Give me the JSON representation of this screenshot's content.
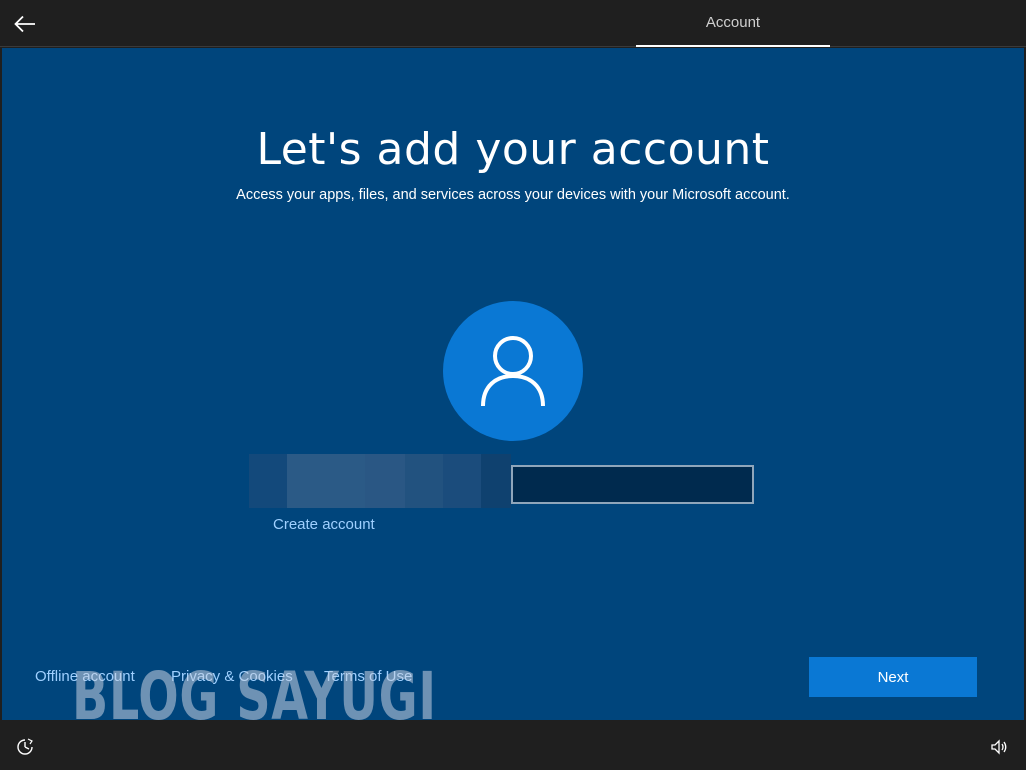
{
  "header": {
    "back_icon": "back-arrow-icon",
    "tab_label": "Account"
  },
  "main": {
    "title": "Let's add your account",
    "subtitle": "Access your apps, files, and services across your devices with your Microsoft account.",
    "avatar_icon": "user-icon",
    "email_input": {
      "value": "",
      "placeholder": ""
    },
    "create_account_label": "Create account",
    "watermark": "BLOG SAYUGI"
  },
  "footer": {
    "links": [
      "Offline account",
      "Privacy & Cookies",
      "Terms of Use"
    ],
    "next_label": "Next"
  },
  "bottombar": {
    "left_icon": "ease-of-access-icon",
    "right_icon": "volume-icon"
  },
  "colors": {
    "background": "#00457c",
    "accent": "#0a78d4",
    "link": "#9fd0ff",
    "chrome": "#1f1f1f"
  }
}
